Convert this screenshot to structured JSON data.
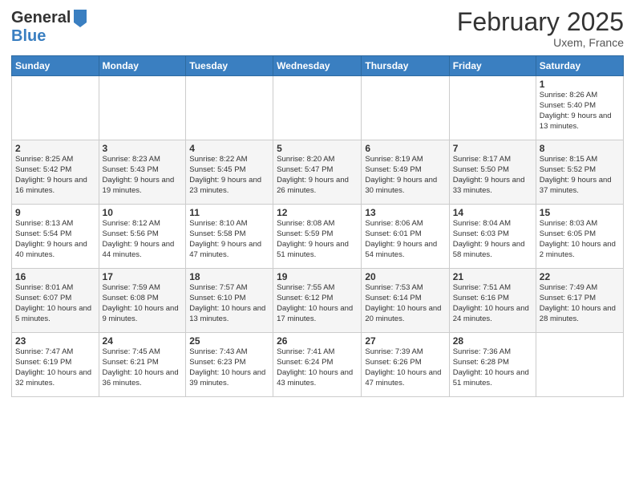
{
  "header": {
    "logo_line1": "General",
    "logo_line2": "Blue",
    "month": "February 2025",
    "location": "Uxem, France"
  },
  "days_of_week": [
    "Sunday",
    "Monday",
    "Tuesday",
    "Wednesday",
    "Thursday",
    "Friday",
    "Saturday"
  ],
  "weeks": [
    [
      {
        "day": "",
        "info": ""
      },
      {
        "day": "",
        "info": ""
      },
      {
        "day": "",
        "info": ""
      },
      {
        "day": "",
        "info": ""
      },
      {
        "day": "",
        "info": ""
      },
      {
        "day": "",
        "info": ""
      },
      {
        "day": "1",
        "info": "Sunrise: 8:26 AM\nSunset: 5:40 PM\nDaylight: 9 hours and 13 minutes."
      }
    ],
    [
      {
        "day": "2",
        "info": "Sunrise: 8:25 AM\nSunset: 5:42 PM\nDaylight: 9 hours and 16 minutes."
      },
      {
        "day": "3",
        "info": "Sunrise: 8:23 AM\nSunset: 5:43 PM\nDaylight: 9 hours and 19 minutes."
      },
      {
        "day": "4",
        "info": "Sunrise: 8:22 AM\nSunset: 5:45 PM\nDaylight: 9 hours and 23 minutes."
      },
      {
        "day": "5",
        "info": "Sunrise: 8:20 AM\nSunset: 5:47 PM\nDaylight: 9 hours and 26 minutes."
      },
      {
        "day": "6",
        "info": "Sunrise: 8:19 AM\nSunset: 5:49 PM\nDaylight: 9 hours and 30 minutes."
      },
      {
        "day": "7",
        "info": "Sunrise: 8:17 AM\nSunset: 5:50 PM\nDaylight: 9 hours and 33 minutes."
      },
      {
        "day": "8",
        "info": "Sunrise: 8:15 AM\nSunset: 5:52 PM\nDaylight: 9 hours and 37 minutes."
      }
    ],
    [
      {
        "day": "9",
        "info": "Sunrise: 8:13 AM\nSunset: 5:54 PM\nDaylight: 9 hours and 40 minutes."
      },
      {
        "day": "10",
        "info": "Sunrise: 8:12 AM\nSunset: 5:56 PM\nDaylight: 9 hours and 44 minutes."
      },
      {
        "day": "11",
        "info": "Sunrise: 8:10 AM\nSunset: 5:58 PM\nDaylight: 9 hours and 47 minutes."
      },
      {
        "day": "12",
        "info": "Sunrise: 8:08 AM\nSunset: 5:59 PM\nDaylight: 9 hours and 51 minutes."
      },
      {
        "day": "13",
        "info": "Sunrise: 8:06 AM\nSunset: 6:01 PM\nDaylight: 9 hours and 54 minutes."
      },
      {
        "day": "14",
        "info": "Sunrise: 8:04 AM\nSunset: 6:03 PM\nDaylight: 9 hours and 58 minutes."
      },
      {
        "day": "15",
        "info": "Sunrise: 8:03 AM\nSunset: 6:05 PM\nDaylight: 10 hours and 2 minutes."
      }
    ],
    [
      {
        "day": "16",
        "info": "Sunrise: 8:01 AM\nSunset: 6:07 PM\nDaylight: 10 hours and 5 minutes."
      },
      {
        "day": "17",
        "info": "Sunrise: 7:59 AM\nSunset: 6:08 PM\nDaylight: 10 hours and 9 minutes."
      },
      {
        "day": "18",
        "info": "Sunrise: 7:57 AM\nSunset: 6:10 PM\nDaylight: 10 hours and 13 minutes."
      },
      {
        "day": "19",
        "info": "Sunrise: 7:55 AM\nSunset: 6:12 PM\nDaylight: 10 hours and 17 minutes."
      },
      {
        "day": "20",
        "info": "Sunrise: 7:53 AM\nSunset: 6:14 PM\nDaylight: 10 hours and 20 minutes."
      },
      {
        "day": "21",
        "info": "Sunrise: 7:51 AM\nSunset: 6:16 PM\nDaylight: 10 hours and 24 minutes."
      },
      {
        "day": "22",
        "info": "Sunrise: 7:49 AM\nSunset: 6:17 PM\nDaylight: 10 hours and 28 minutes."
      }
    ],
    [
      {
        "day": "23",
        "info": "Sunrise: 7:47 AM\nSunset: 6:19 PM\nDaylight: 10 hours and 32 minutes."
      },
      {
        "day": "24",
        "info": "Sunrise: 7:45 AM\nSunset: 6:21 PM\nDaylight: 10 hours and 36 minutes."
      },
      {
        "day": "25",
        "info": "Sunrise: 7:43 AM\nSunset: 6:23 PM\nDaylight: 10 hours and 39 minutes."
      },
      {
        "day": "26",
        "info": "Sunrise: 7:41 AM\nSunset: 6:24 PM\nDaylight: 10 hours and 43 minutes."
      },
      {
        "day": "27",
        "info": "Sunrise: 7:39 AM\nSunset: 6:26 PM\nDaylight: 10 hours and 47 minutes."
      },
      {
        "day": "28",
        "info": "Sunrise: 7:36 AM\nSunset: 6:28 PM\nDaylight: 10 hours and 51 minutes."
      },
      {
        "day": "",
        "info": ""
      }
    ]
  ]
}
